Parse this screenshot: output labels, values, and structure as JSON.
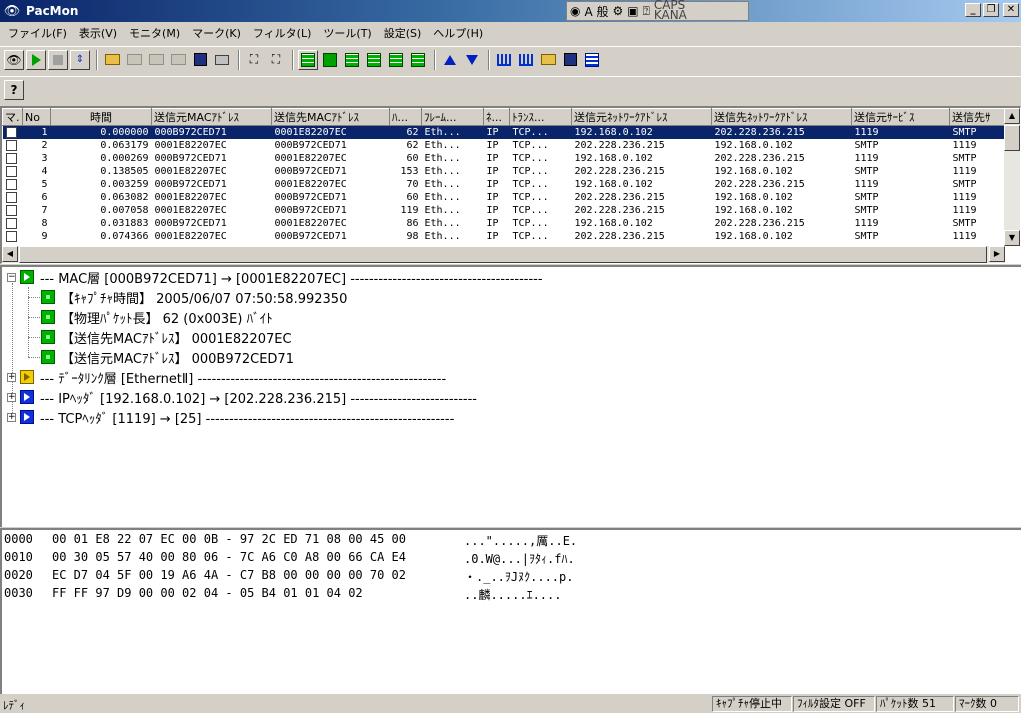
{
  "window": {
    "title": "PacMon"
  },
  "tray": {
    "ime_mode": "A 般",
    "caps": "CAPS",
    "kana": "KANA"
  },
  "menu": [
    "ファイル(F)",
    "表示(V)",
    "モニタ(M)",
    "マーク(K)",
    "フィルタ(L)",
    "ツール(T)",
    "設定(S)",
    "ヘルプ(H)"
  ],
  "toolbar": {
    "help_label": "?"
  },
  "packet_list": {
    "columns": [
      "マ.",
      "No",
      "時間",
      "送信元MACｱﾄﾞﾚｽ",
      "送信先MACｱﾄﾞﾚｽ",
      "ﾊ...",
      "ﾌﾚｰﾑ...",
      "ﾈ...",
      "ﾄﾗﾝｽ...",
      "送信元ﾈｯﾄﾜｰｸｱﾄﾞﾚｽ",
      "送信先ﾈｯﾄﾜｰｸｱﾄﾞﾚｽ",
      "送信元ｻｰﾋﾞｽ",
      "送信先ｻ"
    ],
    "rows": [
      [
        "1",
        "0.000000",
        "000B972CED71",
        "0001E82207EC",
        "62",
        "Eth...",
        "IP",
        "TCP...",
        "192.168.0.102",
        "202.228.236.215",
        "1119",
        "SMTP"
      ],
      [
        "2",
        "0.063179",
        "0001E82207EC",
        "000B972CED71",
        "62",
        "Eth...",
        "IP",
        "TCP...",
        "202.228.236.215",
        "192.168.0.102",
        "SMTP",
        "1119"
      ],
      [
        "3",
        "0.000269",
        "000B972CED71",
        "0001E82207EC",
        "60",
        "Eth...",
        "IP",
        "TCP...",
        "192.168.0.102",
        "202.228.236.215",
        "1119",
        "SMTP"
      ],
      [
        "4",
        "0.138505",
        "0001E82207EC",
        "000B972CED71",
        "153",
        "Eth...",
        "IP",
        "TCP...",
        "202.228.236.215",
        "192.168.0.102",
        "SMTP",
        "1119"
      ],
      [
        "5",
        "0.003259",
        "000B972CED71",
        "0001E82207EC",
        "70",
        "Eth...",
        "IP",
        "TCP...",
        "192.168.0.102",
        "202.228.236.215",
        "1119",
        "SMTP"
      ],
      [
        "6",
        "0.063082",
        "0001E82207EC",
        "000B972CED71",
        "60",
        "Eth...",
        "IP",
        "TCP...",
        "202.228.236.215",
        "192.168.0.102",
        "SMTP",
        "1119"
      ],
      [
        "7",
        "0.007058",
        "0001E82207EC",
        "000B972CED71",
        "119",
        "Eth...",
        "IP",
        "TCP...",
        "202.228.236.215",
        "192.168.0.102",
        "SMTP",
        "1119"
      ],
      [
        "8",
        "0.031883",
        "000B972CED71",
        "0001E82207EC",
        "86",
        "Eth...",
        "IP",
        "TCP...",
        "192.168.0.102",
        "202.228.236.215",
        "1119",
        "SMTP"
      ],
      [
        "9",
        "0.074366",
        "0001E82207EC",
        "000B972CED71",
        "98",
        "Eth...",
        "IP",
        "TCP...",
        "202.228.236.215",
        "192.168.0.102",
        "SMTP",
        "1119"
      ]
    ]
  },
  "tree": {
    "mac": "--- MAC層 [000B972CED71] → [0001E82207EC] -----------------------------------------",
    "mac_children": [
      "【ｷｬﾌﾟﾁｬ時間】 2005/06/07 07:50:58.992350",
      "【物理ﾊﾟｹｯﾄ長】 62 (0x003E) ﾊﾞｲﾄ",
      "【送信先MACｱﾄﾞﾚｽ】 0001E82207EC",
      "【送信元MACｱﾄﾞﾚｽ】 000B972CED71"
    ],
    "datalink": "--- ﾃﾞｰﾀﾘﾝｸ層 [EthernetⅡ] -----------------------------------------------------",
    "ip": "--- IPﾍｯﾀﾞ [192.168.0.102] → [202.228.236.215] ---------------------------",
    "tcp": "--- TCPﾍｯﾀﾞ [1119] → [25] -----------------------------------------------------"
  },
  "hex_dump": [
    {
      "offset": "0000",
      "bytes": "00 01 E8 22 07 EC 00 0B - 97 2C ED 71 08 00 45 00",
      "ascii": "...\".....,厲..E."
    },
    {
      "offset": "0010",
      "bytes": "00 30 05 57 40 00 80 06 - 7C A6 C0 A8 00 66 CA E4",
      "ascii": ".0.W@...|ｦﾀｨ.fﾊ."
    },
    {
      "offset": "0020",
      "bytes": "EC D7 04 5F 00 19 A6 4A - C7 B8 00 00 00 00 70 02",
      "ascii": "・._..ｦJﾇｸ....p."
    },
    {
      "offset": "0030",
      "bytes": "FF FF 97 D9 00 00 02 04 - 05 B4 01 01 04 02",
      "ascii": "..麟.....ｴ...."
    }
  ],
  "status": {
    "ready": "ﾚﾃﾞｨ",
    "capture": "ｷｬﾌﾟﾁｬ停止中",
    "filter": "ﾌｨﾙﾀ設定 OFF",
    "packets": "ﾊﾟｹｯﾄ数 51",
    "marks": "ﾏｰｸ数 0"
  },
  "colors": {
    "title_start": "#0a246a",
    "selection": "#0a246a",
    "node_green": "#00b000",
    "node_yellow": "#f0d000",
    "node_blue": "#1030e0"
  }
}
